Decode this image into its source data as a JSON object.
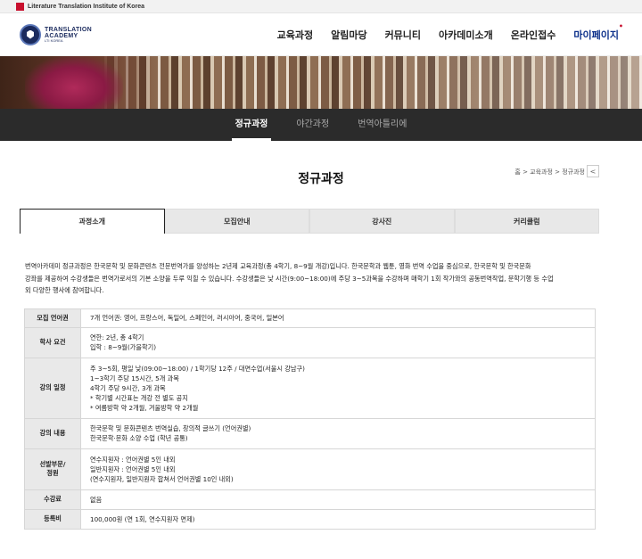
{
  "topbar": {
    "org": "Literature Translation Institute of Korea"
  },
  "logo": {
    "line1": "TRANSLATION",
    "line2": "ACADEMY",
    "line3": "LTI KOREA"
  },
  "gnb": [
    {
      "label": "교육과정"
    },
    {
      "label": "알림마당"
    },
    {
      "label": "커뮤니티"
    },
    {
      "label": "아카데미소개"
    },
    {
      "label": "온라인접수"
    },
    {
      "label": "마이페이지"
    }
  ],
  "subnav": [
    {
      "label": "정규과정"
    },
    {
      "label": "야간과정"
    },
    {
      "label": "번역아틀리에"
    }
  ],
  "page": {
    "title": "정규과정",
    "breadcrumb": "홈 > 교육과정 > 정규과정",
    "share_icon": "share-icon"
  },
  "tabs": [
    {
      "label": "과정소개"
    },
    {
      "label": "모집안내"
    },
    {
      "label": "강사진"
    },
    {
      "label": "커리큘럼"
    }
  ],
  "intro": {
    "line1": "번역아카데미 정규과정은 한국문학 및 문화콘텐츠 전문번역가를 양성하는 2년제 교육과정(총 4학기, 8~9월 개강)입니다. 한국문학과 웹툰, 영화 번역 수업을 중심으로, 한국문학 및 한국문화",
    "line2": "강좌를 제공하여 수강생들은 번역가로서의 기본 소양을 두루 익힐 수 있습니다. 수강생들은 낮 시간(9:00~18:00)에 주당 3~5과목을 수강하며 매학기 1회 작가와의 공동번역작업, 문학기행 등 수업",
    "line3": "외 다양한 행사에 참여합니다."
  },
  "table": {
    "rows": [
      {
        "label": "모집 언어권",
        "lines": [
          "7개 언어권: 영어, 프랑스어, 독일어, 스페인어, 러시아어, 중국어, 일본어"
        ]
      },
      {
        "label": "학사 요건",
        "lines": [
          "연한: 2년, 총 4학기",
          "입학 : 8~9월(가을학기)"
        ]
      },
      {
        "label": "강의 일정",
        "lines": [
          "주 3~5회, 평일 낮(09:00~18:00) / 1학기당 12주 / 대면수업(서울시 강남구)",
          "1~3학기 주당 15시간, 5개 과목",
          "4학기 주당 9시간, 3개 과목",
          "* 학기별 시간표는 개강 전 별도 공지",
          "* 여름방학 약 2개월, 겨울방학 약 2개월"
        ]
      },
      {
        "label": "강의 내용",
        "lines": [
          "한국문학 및 문화콘텐츠 번역실습, 창의적 글쓰기 (언어권별)",
          "한국문학·문화 소양 수업 (학년 공통)"
        ]
      },
      {
        "label": "선발부문/\n정원",
        "lines": [
          "연수지원자 : 언어권별 5인 내외",
          "일반지원자 : 언어권별 5인 내외",
          "(연수지원자, 일반지원자 합쳐서 언어권별 10인 내외)"
        ]
      },
      {
        "label": "수강료",
        "lines": [
          "없음"
        ]
      },
      {
        "label": "등록비",
        "lines": [
          "100,000원 (연 1회, 연수지원자 면제)"
        ]
      }
    ]
  }
}
